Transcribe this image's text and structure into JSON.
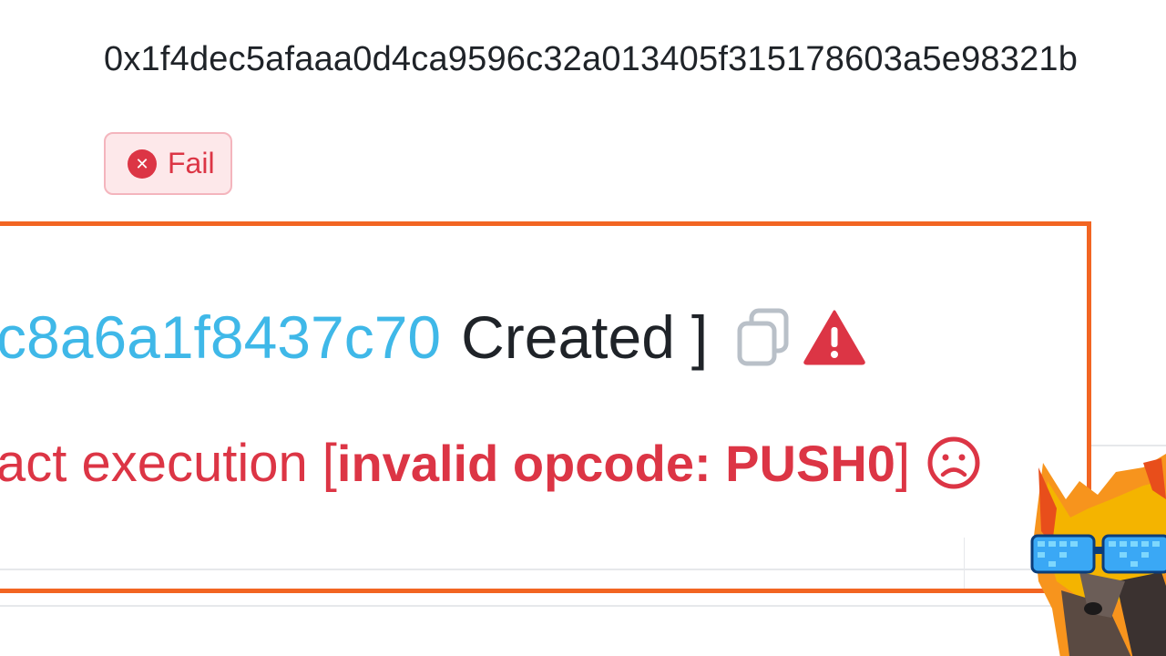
{
  "transaction": {
    "hash": "0x1f4dec5afaaa0d4ca9596c32a013405f315178603a5e98321b"
  },
  "status": {
    "label": "Fail",
    "icon": "x-circle-icon",
    "color": "#dc3545"
  },
  "contract": {
    "address_fragment": "c8a6a1f8437c70",
    "created_label": "Created",
    "bracket_close": "]",
    "copy_icon": "copy-icon",
    "warning_icon": "warning-triangle-icon"
  },
  "error": {
    "prefix": "act execution",
    "bracket_open": "[",
    "detail": "invalid opcode: PUSH0",
    "bracket_close": "]",
    "icon": "sad-face-icon",
    "color": "#dc3545"
  },
  "colors": {
    "highlight_border": "#f26522",
    "link": "#3fb8e8",
    "text": "#1f2328",
    "error": "#dc3545"
  }
}
